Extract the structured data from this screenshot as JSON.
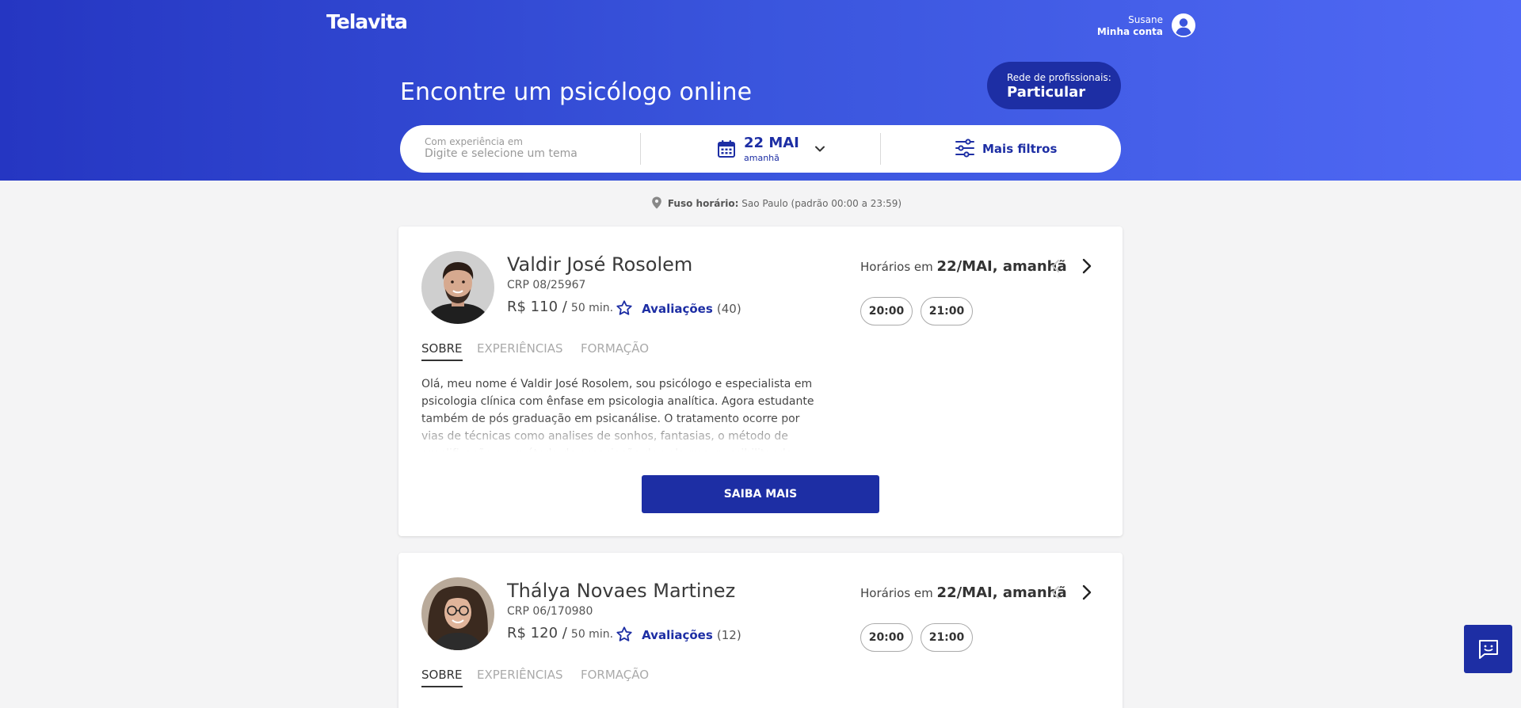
{
  "header": {
    "logo": "Telavita",
    "user_name": "Susane",
    "account_label": "Minha conta"
  },
  "hero": {
    "title": "Encontre um psicólogo online",
    "network": {
      "label": "Rede de profissionais:",
      "value": "Particular"
    }
  },
  "search": {
    "topic_label": "Com experiência em",
    "topic_placeholder": "Digite e selecione um tema",
    "topic_value": "",
    "date": "22 MAI",
    "date_sub": "amanhã",
    "filters_label": "Mais filtros"
  },
  "timezone": {
    "label": "Fuso horário:",
    "value": "Sao Paulo (padrão 00:00 a 23:59)"
  },
  "tabs": [
    "SOBRE",
    "EXPERIÊNCIAS",
    "FORMAÇÃO"
  ],
  "cards": [
    {
      "name": "Valdir José Rosolem",
      "crp": "CRP 08/25967",
      "price": "R$ 110 /",
      "duration": "50 min.",
      "reviews_label": "Avaliações",
      "reviews_count": "(40)",
      "bio": "Olá, meu nome é Valdir José Rosolem, sou psicólogo e especialista em psicologia clínica com ênfase em psicologia analítica. Agora estudante também de pós graduação em psicanálise. O tratamento ocorre por vias de técnicas como analises de sonhos, fantasias, o método de amplificação e o método de associação de palavras, possibilitando uma abertura nas",
      "more_label": "SAIBA MAIS",
      "schedule_prefix": "Horários em",
      "schedule_date": "22/MAI, amanhã",
      "slots": [
        "20:00",
        "21:00"
      ]
    },
    {
      "name": "Thálya Novaes Martinez",
      "crp": "CRP 06/170980",
      "price": "R$ 120 /",
      "duration": "50 min.",
      "reviews_label": "Avaliações",
      "reviews_count": "(12)",
      "schedule_prefix": "Horários em",
      "schedule_date": "22/MAI, amanhã",
      "slots": [
        "20:00",
        "21:00"
      ]
    }
  ],
  "colors": {
    "primary": "#1d2ea4",
    "hero_start": "#2536c2",
    "hero_end": "#5069f5",
    "background": "#f4f4f5"
  },
  "icons": [
    "user-circle-icon",
    "calendar-icon",
    "chevron-down-icon",
    "sliders-icon",
    "location-pin-icon",
    "star-icon",
    "chevron-left-icon",
    "chevron-right-icon",
    "chat-icon"
  ]
}
